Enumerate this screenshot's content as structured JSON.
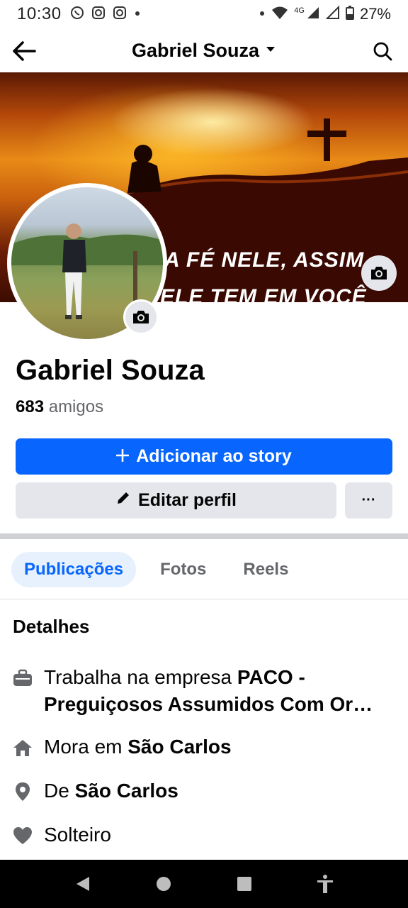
{
  "status_bar": {
    "time": "10:30",
    "network": "4G",
    "battery": "27%"
  },
  "header": {
    "title": "Gabriel Souza"
  },
  "cover": {
    "text_line1": "A FÉ NELE, ASSIM",
    "text_line2": "ELE TEM EM VOCÊ"
  },
  "profile": {
    "name": "Gabriel Souza",
    "friends_count": "683",
    "friends_label": "amigos"
  },
  "actions": {
    "add_story": "Adicionar ao story",
    "edit_profile": "Editar perfil",
    "more": "···"
  },
  "tabs": [
    {
      "label": "Publicações",
      "active": true
    },
    {
      "label": "Fotos",
      "active": false
    },
    {
      "label": "Reels",
      "active": false
    }
  ],
  "details": {
    "title": "Detalhes",
    "work_prefix": "Trabalha na empresa ",
    "work_place": "PACO - Preguiçosos Assumidos Com Or…",
    "lives_prefix": "Mora em ",
    "lives_place": "São Carlos",
    "from_prefix": "De ",
    "from_place": "São Carlos",
    "relationship": "Solteiro"
  },
  "colors": {
    "accent": "#0866ff",
    "button_gray": "#e4e6eb",
    "text_secondary": "#65676b",
    "tab_active_bg": "#e7f1fd"
  },
  "icons": [
    "whatsapp-icon",
    "instagram-icon",
    "wifi-icon",
    "signal-icon",
    "battery-icon",
    "back-arrow-icon",
    "caret-down-icon",
    "search-icon",
    "camera-icon",
    "plus-icon",
    "pencil-icon",
    "briefcase-icon",
    "home-icon",
    "location-pin-icon",
    "heart-icon",
    "nav-back-icon",
    "nav-home-icon",
    "nav-recents-icon",
    "accessibility-icon"
  ]
}
